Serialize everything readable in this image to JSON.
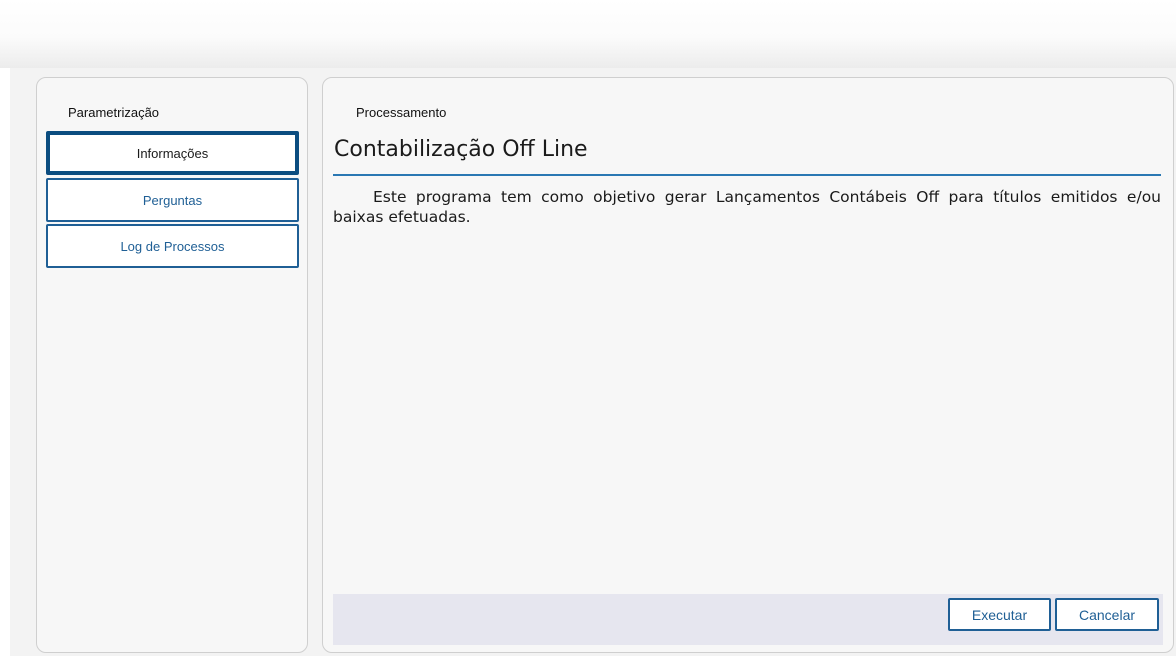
{
  "sidebar": {
    "caption": "Parametrização",
    "items": [
      {
        "label": "Informações",
        "active": true
      },
      {
        "label": "Perguntas",
        "active": false
      },
      {
        "label": "Log de Processos",
        "active": false
      }
    ]
  },
  "main": {
    "caption": "Processamento",
    "title": "Contabilização Off Line",
    "description": "Este programa tem como objetivo gerar Lançamentos Contábeis Off para títulos emitidos e/ou baixas efetuadas."
  },
  "footer": {
    "execute_label": "Executar",
    "cancel_label": "Cancelar"
  },
  "colors": {
    "accent": "#1f5f95",
    "active_border": "#0b4d80",
    "title_rule": "#2a78b3",
    "footer_bg": "#e6e6ef"
  }
}
